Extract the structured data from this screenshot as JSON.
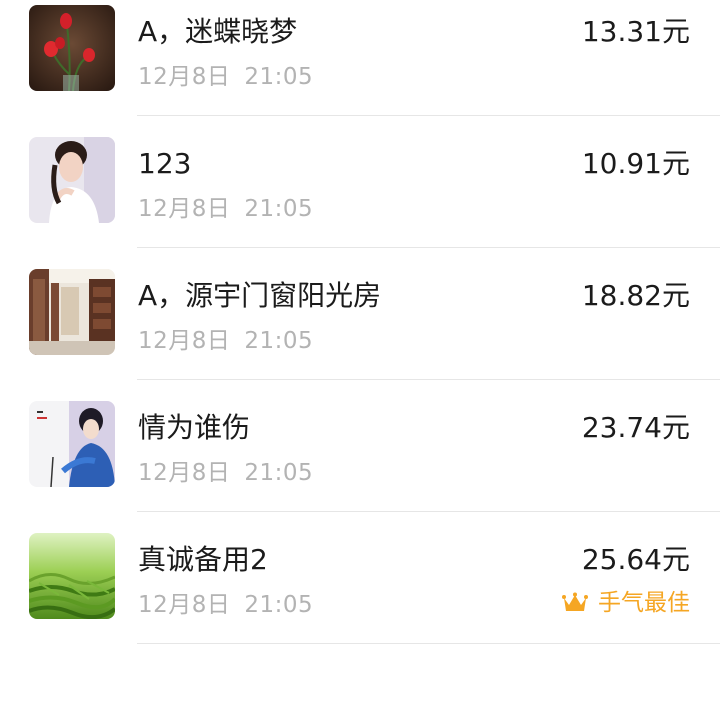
{
  "records": [
    {
      "name": "A，迷蝶晓梦",
      "date": "12月8日",
      "time": "21:05",
      "amount": "13.31元",
      "avatar": "red-tulip-avatar"
    },
    {
      "name": "123",
      "date": "12月8日",
      "time": "21:05",
      "amount": "10.91元",
      "avatar": "woman-portrait-avatar"
    },
    {
      "name": "A，源宇门窗阳光房",
      "date": "12月8日",
      "time": "21:05",
      "amount": "18.82元",
      "avatar": "interior-room-avatar"
    },
    {
      "name": "情为谁伤",
      "date": "12月8日",
      "time": "21:05",
      "amount": "23.74元",
      "avatar": "painted-lady-avatar"
    },
    {
      "name": "真诚备用2",
      "date": "12月8日",
      "time": "21:05",
      "amount": "25.64元",
      "avatar": "green-tea-avatar",
      "badge": "手气最佳"
    }
  ],
  "colors": {
    "badge": "#f5a623",
    "divider": "#e6e6e6",
    "secondary_text": "#b3b3b3"
  }
}
